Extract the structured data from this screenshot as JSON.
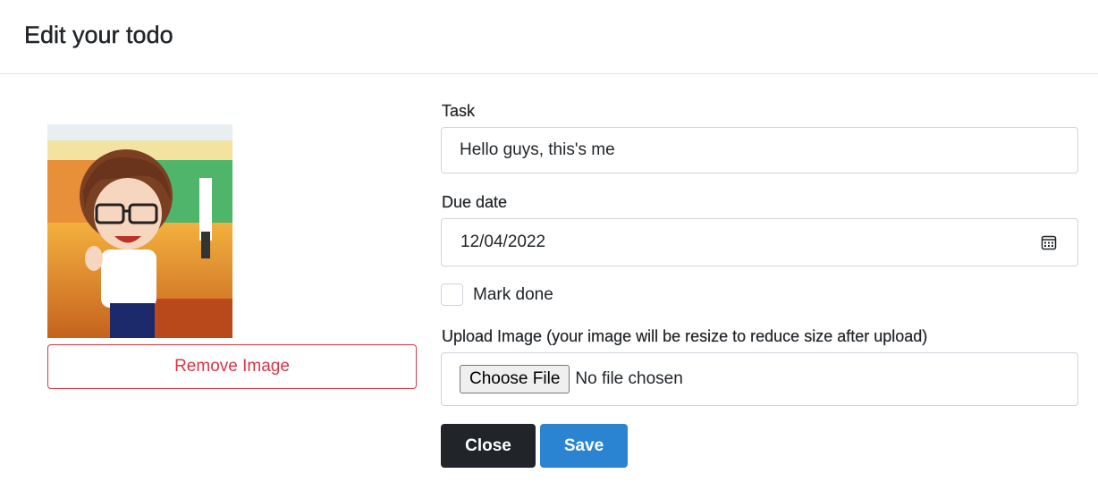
{
  "modal": {
    "title": "Edit your todo"
  },
  "image_panel": {
    "preview_alt": "chibi avatar photo",
    "remove_label": "Remove Image"
  },
  "form": {
    "task": {
      "label": "Task",
      "value": "Hello guys, this's me"
    },
    "due_date": {
      "label": "Due date",
      "value": "12/04/2022",
      "icon": "calendar-icon"
    },
    "mark_done": {
      "label": "Mark done",
      "checked": false
    },
    "upload": {
      "label": "Upload Image (your image will be resize to reduce size after upload)",
      "button_label": "Choose File",
      "status": "No file chosen"
    }
  },
  "actions": {
    "close_label": "Close",
    "save_label": "Save"
  },
  "colors": {
    "danger": "#dc3545",
    "dark": "#212529",
    "primary": "#2a84d2"
  }
}
